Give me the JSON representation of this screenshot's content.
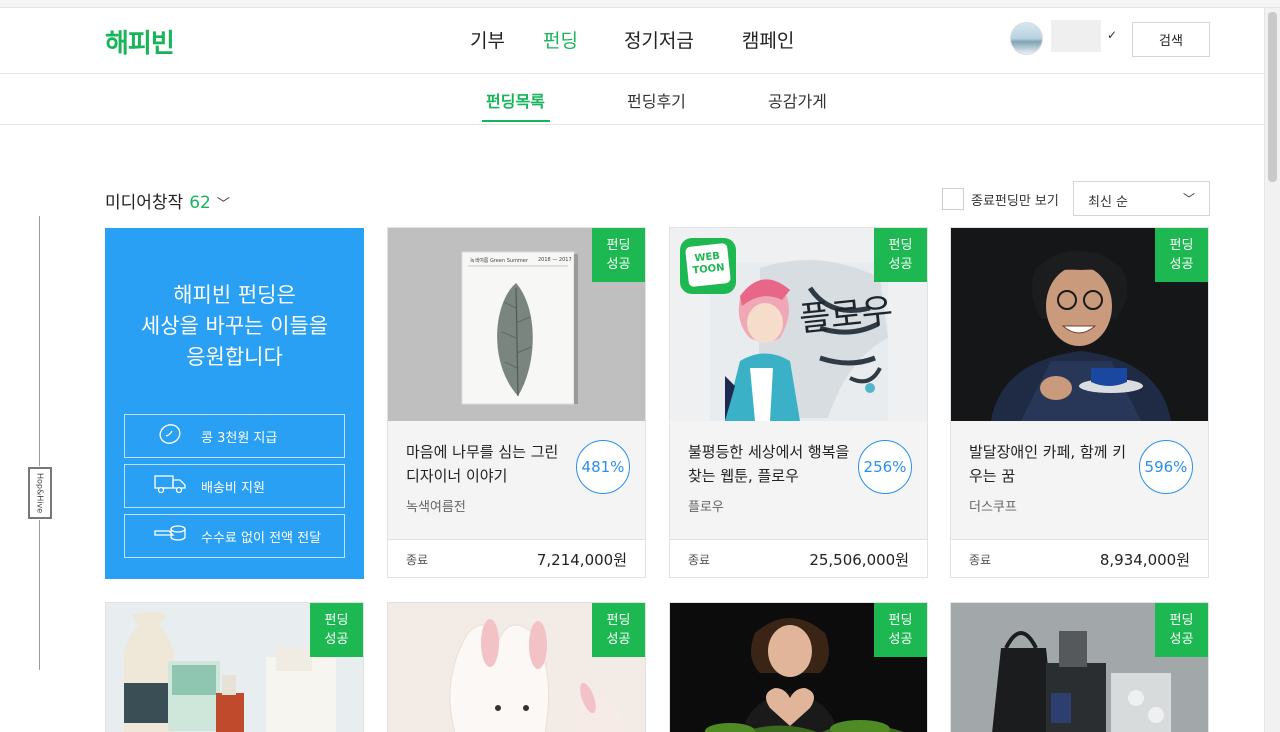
{
  "header": {
    "logo": "해피빈",
    "nav": [
      "기부",
      "펀딩",
      "정기저금",
      "캠페인"
    ],
    "active_nav": "펀딩",
    "checkmark": "✓",
    "search_label": "검색"
  },
  "subnav": {
    "items": [
      "펀딩목록",
      "펀딩후기",
      "공감가게"
    ],
    "active": "펀딩목록"
  },
  "side_tab": {
    "label": "Hop&Hive"
  },
  "filter": {
    "category": "미디어창작",
    "count": "62",
    "checkbox_label": "종료펀딩만 보기",
    "sort_value": "최신 순"
  },
  "promo": {
    "headline_line1": "해피빈 펀딩은",
    "headline_line2": "세상을 바꾸는 이들을",
    "headline_line3": "응원합니다",
    "benefits": [
      {
        "icon": "bean-icon",
        "label": "콩 3천원 지급"
      },
      {
        "icon": "truck-icon",
        "label": "배송비 지원"
      },
      {
        "icon": "coins-icon",
        "label": "수수료 없이 전액 전달"
      }
    ]
  },
  "badge": {
    "line1": "펀딩",
    "line2": "성공"
  },
  "cards": [
    {
      "title": "마음에 나무를 심는 그린 디자이너 이야기",
      "org": "녹색여름전",
      "percent": "481%",
      "status": "종료",
      "amount": "7,214,000원",
      "image": "book-cover-image"
    },
    {
      "title": "불평등한 세상에서 행복을 찾는 웹툰, 플로우",
      "org": "플로우",
      "percent": "256%",
      "status": "종료",
      "amount": "25,506,000원",
      "image": "webtoon-image"
    },
    {
      "title": "발달장애인 카페, 함께 키우는 꿈",
      "org": "더스쿠프",
      "percent": "596%",
      "status": "종료",
      "amount": "8,934,000원",
      "image": "barista-image"
    }
  ],
  "book": {
    "header_left": "녹색여름 Green Summer",
    "header_right": "2018 — 2017"
  },
  "webtoon": {
    "logo_line1": "WEB",
    "logo_line2": "TOON",
    "title": "플로우"
  },
  "row2_cards": [
    {
      "image": "bottle-products-image"
    },
    {
      "image": "rabbit-image"
    },
    {
      "image": "woman-heart-image"
    },
    {
      "image": "bags-image"
    }
  ]
}
